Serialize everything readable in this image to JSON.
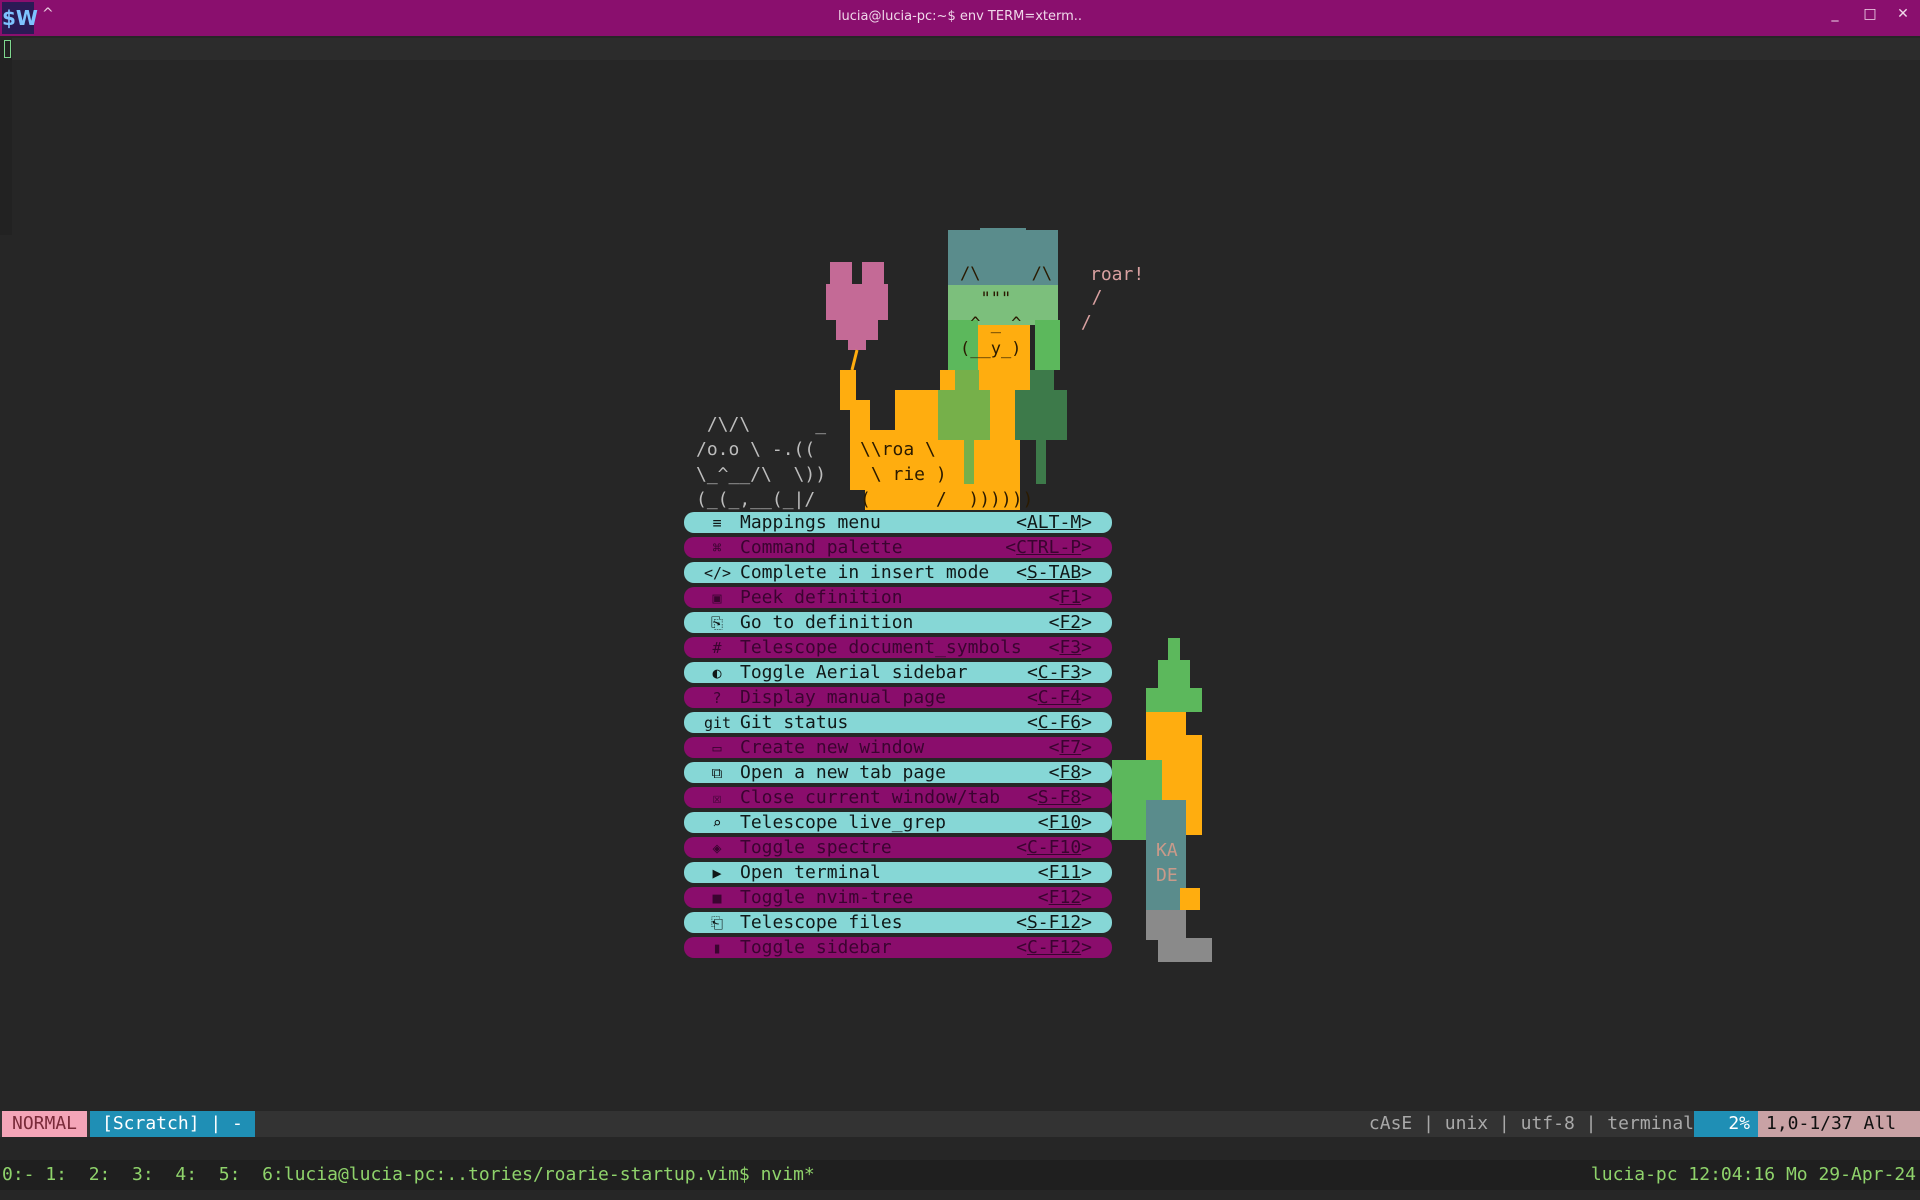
{
  "window": {
    "title": "lucia@lucia-pc:~$ env TERM=xterm..",
    "logo": "$W",
    "chevron": "^",
    "minimize": "_",
    "maximize": "□",
    "close": "✕"
  },
  "ascii": {
    "roar": "roar!",
    "cat": " /\\/\\      _\n/o.o \\ -.((\n\\_^__/\\  \\))\n(_(_,__(_|/",
    "dino_text": "\\\\roa \\\n \\ rie )\n(      /  ))))))",
    "face": "/\\     /\\\n  \"\"\"\n ^ _ ^\n(__y_)",
    "kade": "KA\nDE"
  },
  "menu": {
    "items": [
      {
        "icon": "≡",
        "label": "Mappings menu",
        "key_pre": "<",
        "key": "ALT-M",
        "key_post": ">"
      },
      {
        "icon": "⌘",
        "label": "Command palette",
        "key_pre": "<",
        "key": "CTRL-P",
        "key_post": ">"
      },
      {
        "icon": "</>",
        "label": "Complete in insert mode",
        "key_pre": "<",
        "key": "S-TAB",
        "key_post": ">"
      },
      {
        "icon": "▣",
        "label": "Peek definition",
        "key_pre": "<",
        "key": "F1",
        "key_post": ">"
      },
      {
        "icon": "⎘",
        "label": "Go to definition",
        "key_pre": "<",
        "key": "F2",
        "key_post": ">"
      },
      {
        "icon": "#",
        "label": "Telescope document_symbols",
        "key_pre": "<",
        "key": "F3",
        "key_post": ">"
      },
      {
        "icon": "◐",
        "label": "Toggle Aerial sidebar",
        "key_pre": "<",
        "key": "C-F3",
        "key_post": ">"
      },
      {
        "icon": "?",
        "label": "Display manual page",
        "key_pre": "<",
        "key": "C-F4",
        "key_post": ">"
      },
      {
        "icon": "git",
        "label": "Git status",
        "key_pre": "<",
        "key": "C-F6",
        "key_post": ">"
      },
      {
        "icon": "▭",
        "label": "Create new window",
        "key_pre": "<",
        "key": "F7",
        "key_post": ">"
      },
      {
        "icon": "⧉",
        "label": "Open a new tab page",
        "key_pre": "<",
        "key": "F8",
        "key_post": ">"
      },
      {
        "icon": "☒",
        "label": "Close current window/tab",
        "key_pre": "<",
        "key": "S-F8",
        "key_post": ">"
      },
      {
        "icon": "⌕",
        "label": "Telescope live_grep",
        "key_pre": "<",
        "key": "F10",
        "key_post": ">"
      },
      {
        "icon": "◈",
        "label": "Toggle spectre",
        "key_pre": "<",
        "key": "C-F10",
        "key_post": ">"
      },
      {
        "icon": "▶",
        "label": "Open terminal",
        "key_pre": "<",
        "key": "F11",
        "key_post": ">"
      },
      {
        "icon": "■",
        "label": "Toggle nvim-tree",
        "key_pre": "<",
        "key": "F12",
        "key_post": ">"
      },
      {
        "icon": "⎗",
        "label": "Telescope files",
        "key_pre": "<",
        "key": "S-F12",
        "key_post": ">"
      },
      {
        "icon": "▮",
        "label": "Toggle sidebar",
        "key_pre": "<",
        "key": "C-F12",
        "key_post": ">"
      }
    ]
  },
  "statusline": {
    "mode": "NORMAL",
    "buffer": "[Scratch] | -",
    "file_info": "cAsE | unix | utf-8 | terminal",
    "percent": "2%",
    "position": "1,0-1/37 All"
  },
  "tmux": {
    "windows": "0:- 1:  2:  3:  4:  5:  6:lucia@lucia-pc:..tories/roarie-startup.vim$ nvim*",
    "right": "lucia-pc 12:04:16 Mo 29-Apr-24"
  },
  "colors": {
    "title_bar": "#8a0f6e",
    "menu_odd": "#86d7d6",
    "menu_even": "#8a0d6c",
    "mode_bg": "#f4a5b8",
    "accent_blue": "#1f8fb5",
    "orange": "#ffad0f",
    "green": "#5cb85c"
  }
}
